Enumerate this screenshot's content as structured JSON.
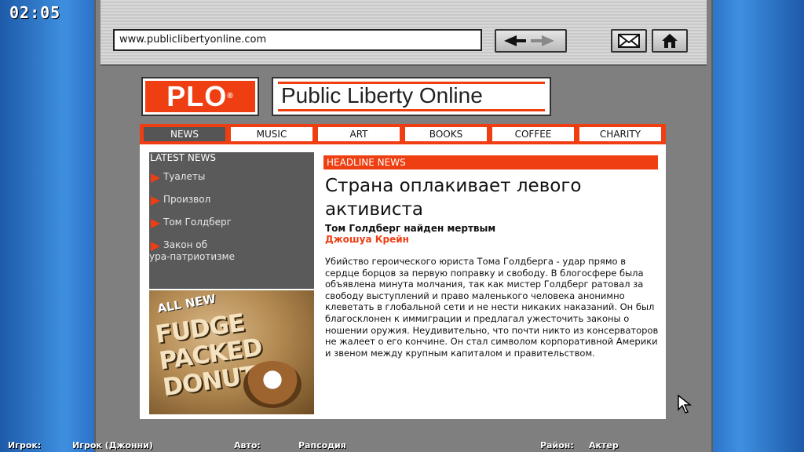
{
  "clock": "02:05",
  "browser": {
    "url": "www.publiclibertyonline.com"
  },
  "site": {
    "logo_short": "PLO",
    "logo_reg": "®",
    "logo_name": "Public Liberty Online"
  },
  "menu": {
    "items": [
      "NEWS",
      "MUSIC",
      "ART",
      "BOOKS",
      "COFFEE",
      "CHARITY"
    ],
    "active": "NEWS"
  },
  "sidebar": {
    "title": "LATEST NEWS",
    "items": [
      "Туалеты",
      "Произвол",
      "Том Голдберг"
    ],
    "last_item_line1": "Закон об",
    "last_item_line2": "ура-патриотизме"
  },
  "ad": {
    "line1": "ALL NEW",
    "line2": "FUDGE PACKED DONUTS"
  },
  "article": {
    "section": "HEADLINE NEWS",
    "title": "Страна оплакивает левого активиста",
    "subtitle": "Том Голдберг найден мертвым",
    "author": "Джошуа Крейн",
    "body": "Убийство героического юриста Тома Голдберга - удар прямо в сердце борцов за первую поправку и свободу. В блогосфере была объявлена минута молчания, так как мистер Голдберг ратовал за свободу выступлений и право маленького человека анонимно клеветать в глобальной сети и не нести никаких наказаний. Он был благосклонен к иммиграции и предлагал ужесточить законы о ношении оружия. Неудивительно, что почти никто из консерваторов не жалеет о его кончине. Он стал символом корпоративной Америки и звеном между крупным капиталом и правительством."
  },
  "status_bar": {
    "player_label": "Игрок:",
    "player_value": "Игрок (Джонни)",
    "car_label": "Авто:",
    "car_value": "Рапсодия",
    "district_label": "Район:",
    "district_value": "Актер"
  },
  "colors": {
    "accent": "#ee3e12",
    "sidebar_bg": "#5a5a5a",
    "window_bg": "#7f7f7f"
  },
  "icons": [
    "back-forward-icon",
    "mail-icon",
    "home-icon",
    "cursor-icon"
  ]
}
